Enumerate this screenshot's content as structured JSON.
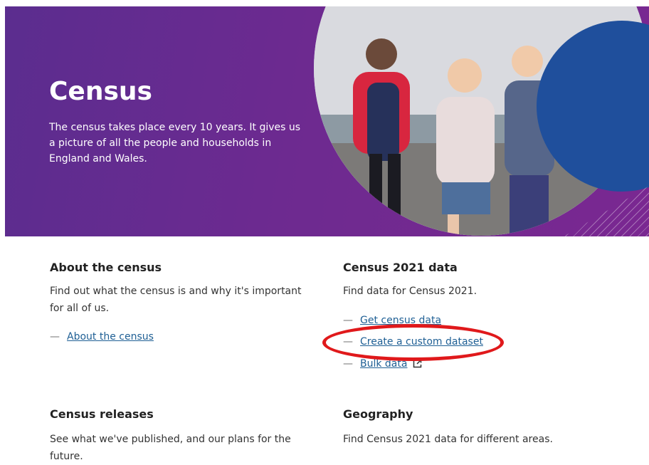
{
  "hero": {
    "title": "Census",
    "description": "The census takes place every 10 years. It gives us a picture of all the people and households in England and Wales."
  },
  "sections": [
    {
      "title": "About the census",
      "description": "Find out what the census is and why it's important for all of us.",
      "links": [
        "About the census"
      ]
    },
    {
      "title": "Census 2021 data",
      "description": "Find data for Census 2021.",
      "links": [
        "Get census data",
        "Create a custom dataset",
        "Bulk data"
      ]
    },
    {
      "title": "Census releases",
      "description": "See what we've published, and our plans for the future."
    },
    {
      "title": "Geography",
      "description": "Find Census 2021 data for different areas."
    }
  ],
  "colors": {
    "hero_purple": "#6a2c91",
    "link": "#206095",
    "highlight": "#e0191b"
  }
}
